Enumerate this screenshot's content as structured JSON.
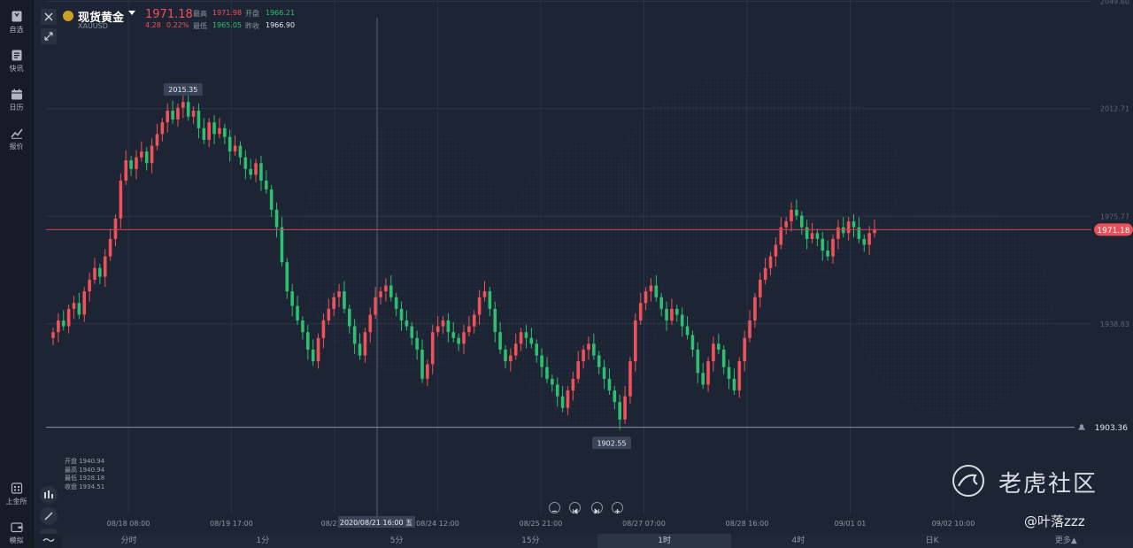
{
  "sidebar": {
    "items": [
      {
        "label": "自选",
        "icon": "bookmark-icon"
      },
      {
        "label": "快讯",
        "icon": "news-icon"
      },
      {
        "label": "日历",
        "icon": "calendar-icon"
      },
      {
        "label": "报价",
        "icon": "trend-line-icon"
      }
    ],
    "bottom_items": [
      {
        "label": "上金所",
        "icon": "exchange-icon"
      },
      {
        "label": "模拟",
        "icon": "wallet-icon"
      }
    ]
  },
  "header": {
    "title": "现货黄金",
    "symbol": "XAUUSD",
    "price": "1971.18",
    "change": "4.28",
    "change_pct": "0.22%",
    "high_label": "最高",
    "high_value": "1971.98",
    "open_label": "开盘",
    "open_value": "1966.21",
    "low_label": "最低",
    "low_value": "1965.05",
    "prev_close_label": "昨收",
    "prev_close_value": "1966.90"
  },
  "crosshair_info": {
    "open": "开盘 1940.94",
    "high": "最高 1940.94",
    "low": "最低 1928.18",
    "close": "收盘 1934.51",
    "time_label": "2020/08/21 16:00 五"
  },
  "chart_data": {
    "type": "candlestick",
    "y_axis_ticks": [
      "2049.60",
      "2012.71",
      "1975.77",
      "1938.83"
    ],
    "y_axis_tick_values": [
      2049.6,
      2012.71,
      1975.77,
      1938.83
    ],
    "ylim": [
      1892,
      2050
    ],
    "x_axis_ticks": [
      "08/18 08:00",
      "08/19 17:00",
      "08/21 0",
      "08/24 12:00",
      "08/25 21:00",
      "08/27 07:00",
      "08/28 16:00",
      "09/01 01",
      "09/02 10:00"
    ],
    "current_price": "1971.18",
    "current_price_value": 1971.18,
    "alert_price": "1903.36",
    "alert_price_value": 1903.36,
    "max_label": "2015.35",
    "max_value": 2015.35,
    "min_label": "1902.55",
    "min_value": 1902.55,
    "closes": [
      1936,
      1940,
      1938,
      1944,
      1946,
      1942,
      1950,
      1954,
      1958,
      1955,
      1962,
      1968,
      1975,
      1988,
      1995,
      1992,
      1996,
      1998,
      1994,
      2000,
      2004,
      2008,
      2012,
      2009,
      2013,
      2015,
      2010,
      2012,
      2006,
      2002,
      2008,
      2004,
      2006,
      2003,
      1998,
      2000,
      1996,
      1992,
      1990,
      1994,
      1988,
      1985,
      1978,
      1972,
      1960,
      1950,
      1945,
      1940,
      1936,
      1930,
      1926,
      1934,
      1940,
      1944,
      1948,
      1950,
      1944,
      1938,
      1932,
      1928,
      1936,
      1942,
      1948,
      1950,
      1952,
      1948,
      1944,
      1940,
      1938,
      1934,
      1930,
      1920,
      1925,
      1936,
      1938,
      1940,
      1936,
      1934,
      1932,
      1936,
      1938,
      1942,
      1948,
      1950,
      1944,
      1936,
      1930,
      1926,
      1928,
      1932,
      1936,
      1934,
      1932,
      1928,
      1924,
      1920,
      1918,
      1914,
      1910,
      1916,
      1920,
      1926,
      1930,
      1932,
      1928,
      1924,
      1920,
      1916,
      1912,
      1906,
      1914,
      1926,
      1940,
      1946,
      1950,
      1952,
      1948,
      1944,
      1940,
      1944,
      1942,
      1938,
      1935,
      1930,
      1922,
      1918,
      1926,
      1932,
      1930,
      1924,
      1920,
      1916,
      1926,
      1934,
      1940,
      1948,
      1954,
      1958,
      1962,
      1966,
      1972,
      1974,
      1978,
      1976,
      1972,
      1968,
      1970,
      1968,
      1964,
      1962,
      1968,
      1972,
      1970,
      1974,
      1972,
      1968,
      1966,
      1970,
      1971.18
    ]
  },
  "bottom_bar": {
    "tabs": [
      "分时",
      "1分",
      "5分",
      "15分",
      "1时",
      "4时",
      "日K",
      "更多▲"
    ],
    "active_index": 4
  },
  "watermark": {
    "brand": "老虎社区",
    "user": "@叶落zzz"
  },
  "colors": {
    "up": "#f0525a",
    "down": "#2fbf71",
    "background": "#1d2433",
    "grid": "#2c3446"
  }
}
